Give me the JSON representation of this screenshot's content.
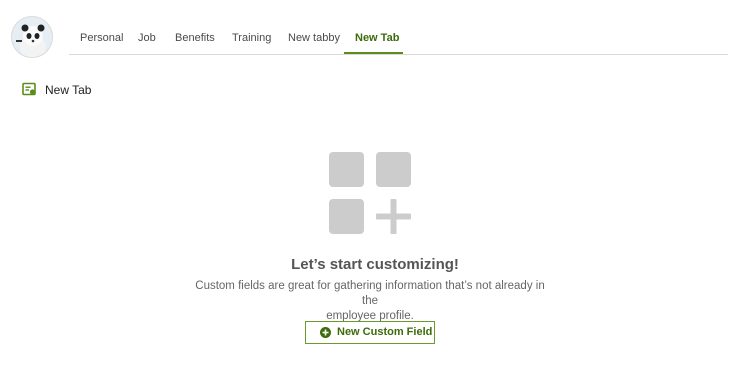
{
  "tabs": [
    {
      "label": "Personal"
    },
    {
      "label": "Job"
    },
    {
      "label": "Benefits"
    },
    {
      "label": "Training"
    },
    {
      "label": "New tabby"
    },
    {
      "label": "New Tab"
    }
  ],
  "active_tab": "New Tab",
  "section": {
    "title": "New Tab",
    "icon": "custom-fields-icon"
  },
  "empty_state": {
    "title": "Let’s start customizing!",
    "description_line1": "Custom fields are great for gathering information that’s not already in the",
    "description_line2": "employee profile.",
    "illustration_icon": "grid-plus-icon"
  },
  "cta": {
    "label": "New Custom Field",
    "icon": "plus-circle-icon"
  },
  "colors": {
    "accent": "#5c8d1b",
    "accent_text": "#3d6b0b",
    "placeholder": "#cccccc"
  }
}
